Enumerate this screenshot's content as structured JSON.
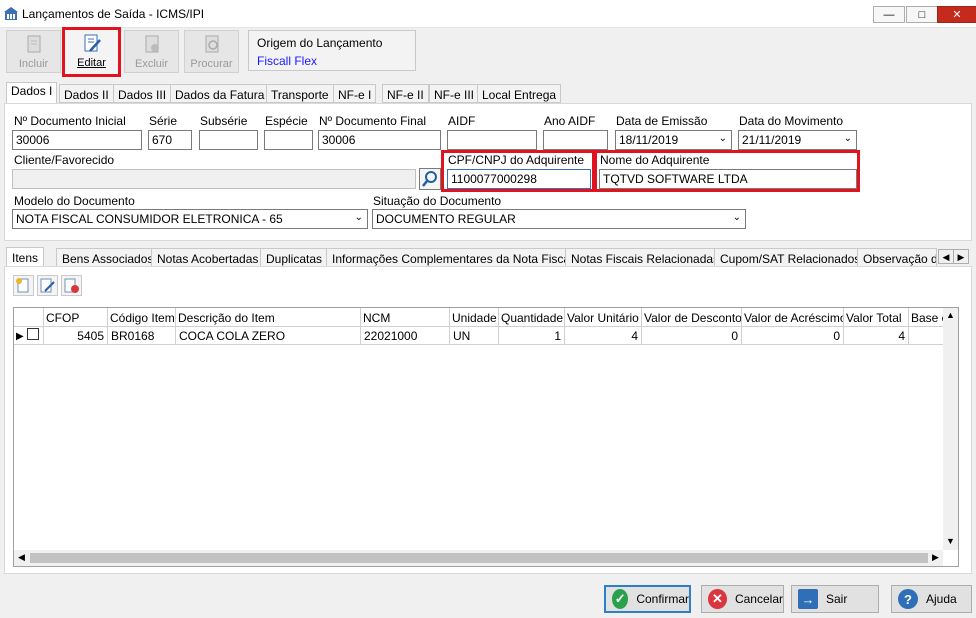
{
  "window": {
    "title": "Lançamentos de Saída - ICMS/IPI"
  },
  "toolbar": {
    "incluir": "Incluir",
    "editar": "Editar",
    "excluir": "Excluir",
    "procurar": "Procurar"
  },
  "origem": {
    "label": "Origem do Lançamento",
    "value": "Fiscall Flex"
  },
  "tabs": [
    "Dados I",
    "Dados II",
    "Dados III",
    "Dados da Fatura",
    "Transporte",
    "NF-e I",
    "NF-e II",
    "NF-e III",
    "Local Entrega"
  ],
  "form": {
    "doc_inicial": {
      "label": "Nº Documento Inicial",
      "value": "30006"
    },
    "serie": {
      "label": "Série",
      "value": "670"
    },
    "subserie": {
      "label": "Subsérie",
      "value": ""
    },
    "especie": {
      "label": "Espécie",
      "value": ""
    },
    "doc_final": {
      "label": "Nº Documento Final",
      "value": "30006"
    },
    "aidf": {
      "label": "AIDF",
      "value": ""
    },
    "ano_aidf": {
      "label": "Ano AIDF",
      "value": ""
    },
    "data_emissao": {
      "label": "Data de Emissão",
      "value": "18/11/2019"
    },
    "data_movimento": {
      "label": "Data do Movimento",
      "value": "21/11/2019"
    },
    "cliente": {
      "label": "Cliente/Favorecido",
      "value": ""
    },
    "cpf_cnpj": {
      "label": "CPF/CNPJ do Adquirente",
      "value": "1100077000298"
    },
    "nome_adquirente": {
      "label": "Nome do Adquirente",
      "value": "TQTVD SOFTWARE LTDA"
    },
    "modelo": {
      "label": "Modelo do Documento",
      "value": "NOTA FISCAL CONSUMIDOR ELETRONICA - 65"
    },
    "situacao": {
      "label": "Situação do Documento",
      "value": "DOCUMENTO REGULAR"
    }
  },
  "subtabs": [
    "Itens",
    "Bens Associados",
    "Notas Acobertadas",
    "Duplicatas",
    "Informações Complementares da Nota Fiscal",
    "Notas Fiscais Relacionadas",
    "Cupom/SAT Relacionados",
    "Observação d"
  ],
  "grid": {
    "columns": [
      "CFOP",
      "Código Item",
      "Descrição do Item",
      "NCM",
      "Unidade",
      "Quantidade",
      "Valor Unitário",
      "Valor de Desconto",
      "Valor de Acréscimo",
      "Valor Total",
      "Base c"
    ],
    "rows": [
      [
        "5405",
        "BR0168",
        "COCA COLA ZERO",
        "22021000",
        "UN",
        "1",
        "4",
        "0",
        "0",
        "4",
        ""
      ]
    ]
  },
  "footer": {
    "confirmar": "Confirmar",
    "cancelar": "Cancelar",
    "sair": "Sair",
    "ajuda": "Ajuda"
  },
  "colors": {
    "highlight": "#e0141e",
    "link": "#1a1aff"
  }
}
